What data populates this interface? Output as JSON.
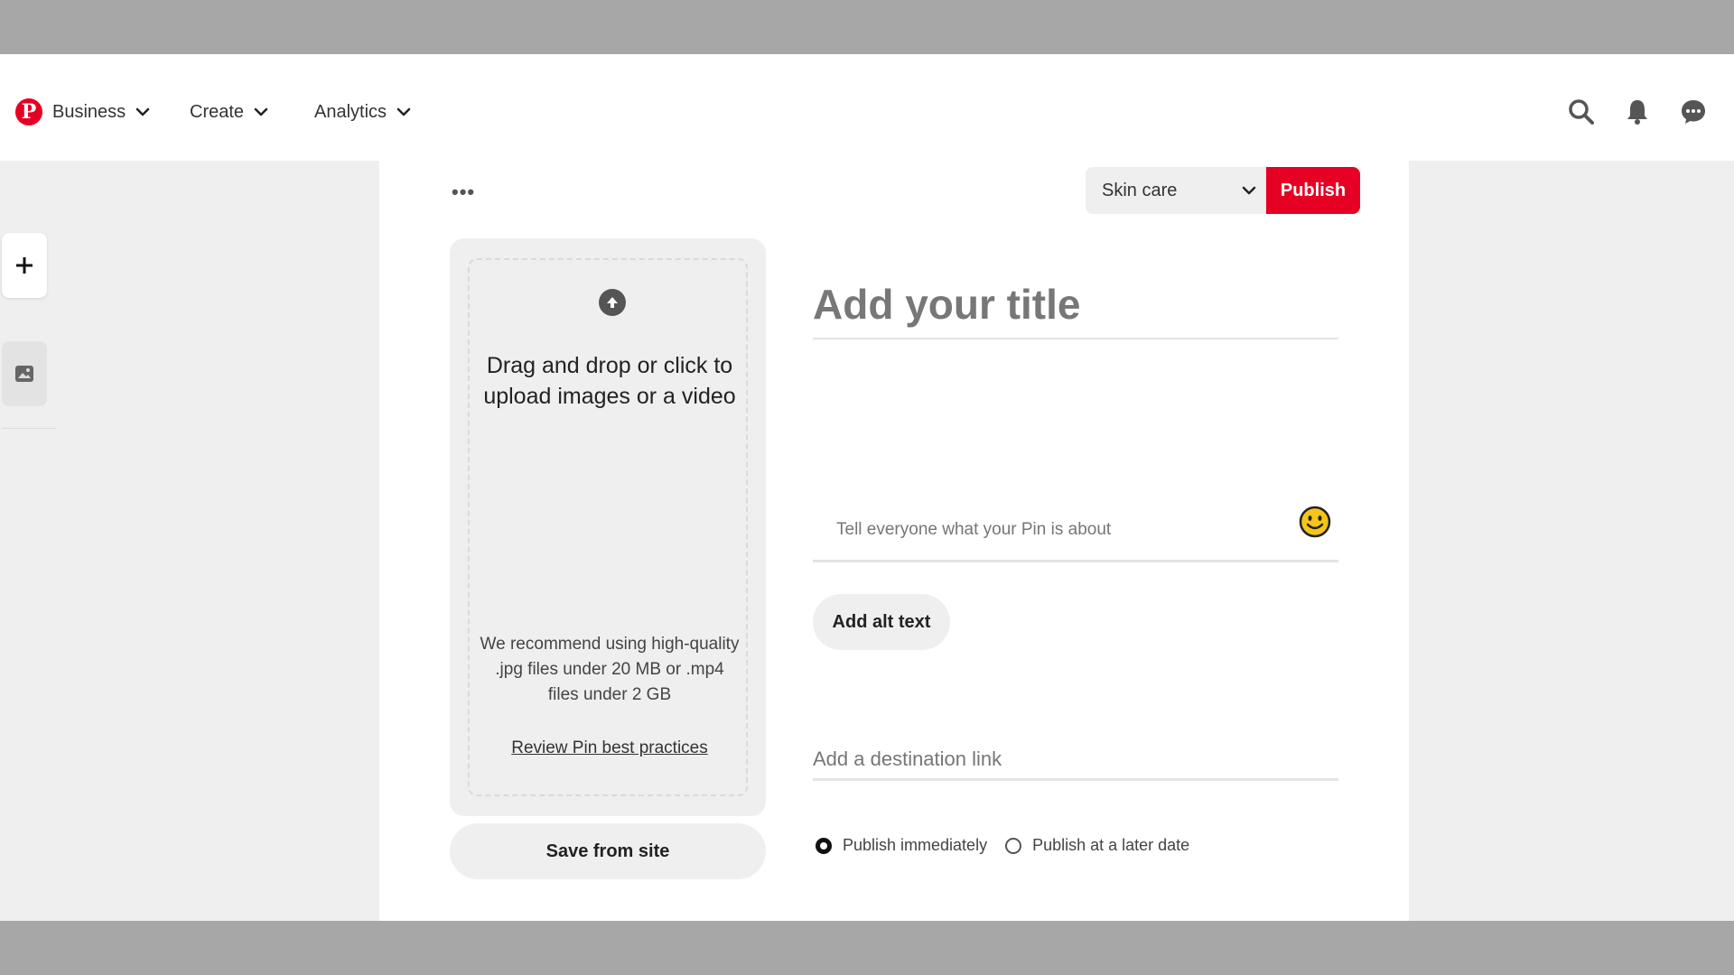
{
  "header": {
    "nav": [
      {
        "label": "Business"
      },
      {
        "label": "Create"
      },
      {
        "label": "Analytics"
      }
    ],
    "icons": [
      "search-icon",
      "bell-icon",
      "messages-icon"
    ]
  },
  "rail": {
    "add_icon": "plus-icon",
    "image_icon": "image-icon"
  },
  "toolbar": {
    "more_label": "•••",
    "board_value": "Skin care",
    "publish_label": "Publish"
  },
  "upload": {
    "main_text": "Drag and drop or click to upload images or a video",
    "recommend_text": "We recommend using high-quality .jpg files under 20 MB or .mp4 files under 2 GB",
    "review_link": "Review Pin best practices",
    "save_from_site": "Save from site"
  },
  "form": {
    "title_placeholder": "Add your title",
    "description_placeholder": "Tell everyone what your Pin is about",
    "alt_text_label": "Add alt text",
    "link_placeholder": "Add a destination link",
    "publish_options": [
      {
        "label": "Publish immediately",
        "selected": true
      },
      {
        "label": "Publish at a later date",
        "selected": false
      }
    ]
  },
  "colors": {
    "brand": "#e60023",
    "background_frame": "#a7a7a7",
    "panel": "#efefef"
  }
}
